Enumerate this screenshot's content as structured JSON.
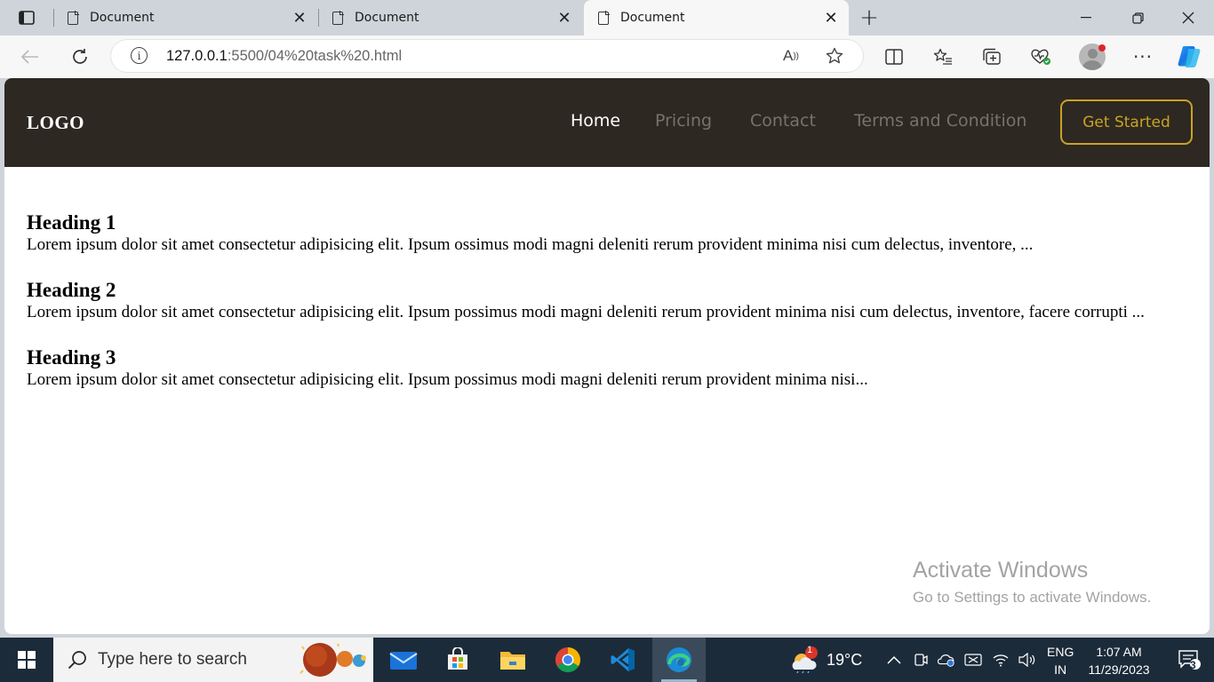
{
  "browser": {
    "tabs": [
      {
        "title": "Document",
        "active": false
      },
      {
        "title": "Document",
        "active": false
      },
      {
        "title": "Document",
        "active": true
      }
    ],
    "url_host": "127.0.0.1",
    "url_path": ":5500/04%20task%20.html",
    "profile_notification": true
  },
  "site": {
    "logo": "LOGO",
    "nav": [
      {
        "label": "Home",
        "active": true
      },
      {
        "label": "Pricing",
        "active": false
      },
      {
        "label": "Contact",
        "active": false
      },
      {
        "label": "Terms and Condition",
        "active": false
      }
    ],
    "cta_label": "Get Started",
    "accent_color": "#c9a227",
    "nav_bg": "#2d2821"
  },
  "content": {
    "sections": [
      {
        "heading": "Heading 1",
        "body": "Lorem ipsum dolor sit amet consectetur adipisicing elit. Ipsum ossimus modi magni deleniti rerum provident minima nisi cum delectus, inventore, ..."
      },
      {
        "heading": "Heading 2",
        "body": "Lorem ipsum dolor sit amet consectetur adipisicing elit. Ipsum possimus modi magni deleniti rerum provident minima nisi cum delectus, inventore, facere corrupti ..."
      },
      {
        "heading": "Heading 3",
        "body": "Lorem ipsum dolor sit amet consectetur adipisicing elit. Ipsum possimus modi magni deleniti rerum provident minima nisi..."
      }
    ]
  },
  "watermark": {
    "title": "Activate Windows",
    "subtitle": "Go to Settings to activate Windows."
  },
  "taskbar": {
    "search_placeholder": "Type here to search",
    "weather_badge": "1",
    "temperature": "19°C",
    "language_top": "ENG",
    "language_bottom": "IN",
    "time": "1:07 AM",
    "date": "11/29/2023",
    "notification_count": "3"
  }
}
